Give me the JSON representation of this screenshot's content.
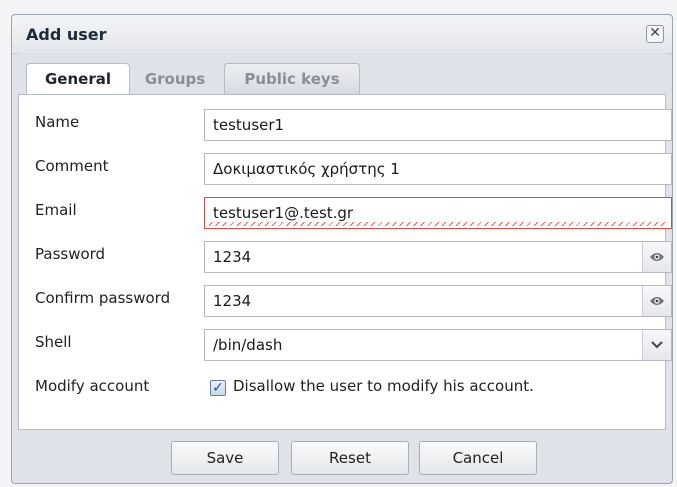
{
  "dialog": {
    "title": "Add user",
    "close_symbol": "✕"
  },
  "tabs": [
    {
      "label": "General",
      "active": true
    },
    {
      "label": "Groups",
      "active": false
    },
    {
      "label": "Public keys",
      "active": false
    }
  ],
  "form": {
    "name": {
      "label": "Name",
      "value": "testuser1"
    },
    "comment": {
      "label": "Comment",
      "value": "Δοκιμαστικός χρήστης 1"
    },
    "email": {
      "label": "Email",
      "value": "testuser1@.test.gr",
      "invalid": true
    },
    "password": {
      "label": "Password",
      "value": "1234",
      "icon": "eye-icon"
    },
    "confirm_password": {
      "label": "Confirm password",
      "value": "1234",
      "icon": "eye-icon"
    },
    "shell": {
      "label": "Shell",
      "value": "/bin/dash",
      "icon": "chevron-down-icon"
    },
    "modify_account": {
      "label": "Modify account",
      "checked": true,
      "checkbox_label": "Disallow the user to modify his account."
    }
  },
  "buttons": {
    "save": "Save",
    "reset": "Reset",
    "cancel": "Cancel"
  },
  "colors": {
    "invalid_border": "#d94b4b",
    "check": "#1b4da3"
  }
}
